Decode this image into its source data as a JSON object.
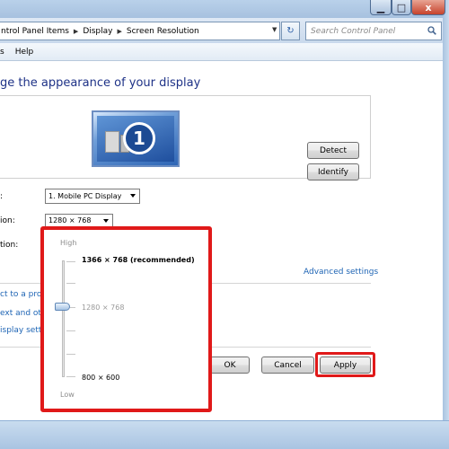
{
  "titlebar": {
    "minimize": "▁",
    "maximize": "□",
    "close": "x"
  },
  "address": {
    "crumbs": [
      "ntrol Panel Items",
      "Display",
      "Screen Resolution"
    ],
    "refresh": "↻",
    "search_placeholder": "Search Control Panel"
  },
  "menu": {
    "items": [
      "s",
      "Help"
    ]
  },
  "main": {
    "heading": "ge the appearance of your display",
    "monitor_number": "1",
    "detect_label": "Detect",
    "identify_label": "Identify",
    "display_label": ":",
    "display_value": "1. Mobile PC Display",
    "resolution_label": "ion:",
    "resolution_value": "1280 × 768",
    "orientation_label": "tion:",
    "advanced_link": "Advanced settings",
    "link_project": "ct to a proje",
    "link_text": "ext and othe",
    "link_display": "isplay setti",
    "ok_label": "OK",
    "cancel_label": "Cancel",
    "apply_label": "Apply"
  },
  "resolution_popup": {
    "high_label": "High",
    "low_label": "Low",
    "options": [
      "1366 × 768 (recommended)",
      "1280 × 768",
      "800 × 600"
    ],
    "selected": "1280 × 768"
  },
  "colors": {
    "heading": "#1e3287",
    "link": "#1e64b4",
    "highlight": "#e01919"
  }
}
